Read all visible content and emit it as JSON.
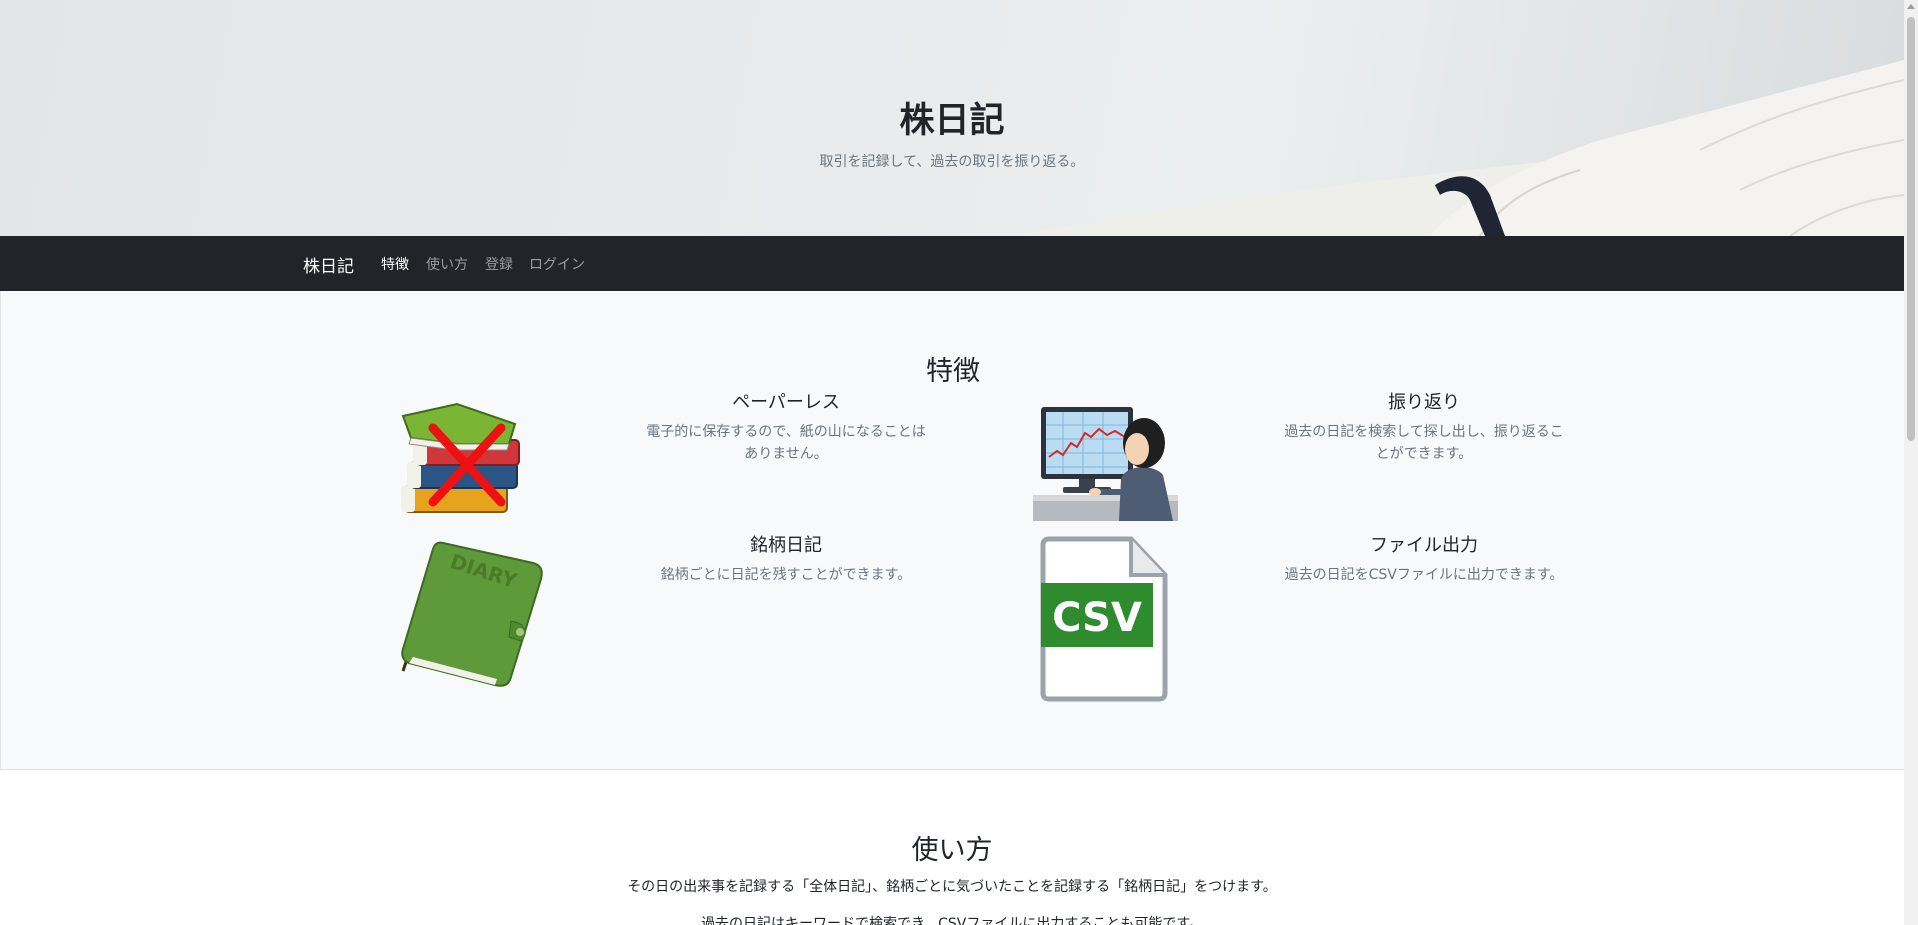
{
  "hero": {
    "title": "株日記",
    "subtitle": "取引を記録して、過去の取引を振り返る。"
  },
  "navbar": {
    "brand": "株日記",
    "items": [
      "特徴",
      "使い方",
      "登録",
      "ログイン"
    ],
    "active": "特徴"
  },
  "features": {
    "title": "特徴",
    "items": [
      {
        "heading": "ペーパーレス",
        "text_line1": "電子的に保存するので、紙の山になることは",
        "text_line2": "ありません。",
        "icon": "crossed-books-icon"
      },
      {
        "heading": "振り返り",
        "text_line1": "過去の日記を検索して探し出し、振り返るこ",
        "text_line2": "とができます。",
        "icon": "person-at-computer-icon"
      },
      {
        "heading": "銘柄日記",
        "text_line1": "銘柄ごとに日記を残すことができます。",
        "text_line2": "",
        "icon": "diary-book-icon"
      },
      {
        "heading": "ファイル出力",
        "text_line1": "過去の日記をCSVファイルに出力できます。",
        "text_line2": "",
        "icon": "csv-file-icon"
      }
    ],
    "csv_label": "CSV",
    "diary_label": "DIARY"
  },
  "usage": {
    "title": "使い方",
    "text1": "その日の出来事を記録する「全体日記」、銘柄ごとに気づいたことを記録する「銘柄日記」をつけます。",
    "text2": "過去の日記はキーワードで検索でき、CSVファイルに出力することも可能です。"
  },
  "colors": {
    "navbar_bg": "#212529",
    "section_bg": "#f8f9fa",
    "muted_text": "#6c757d",
    "csv_green": "#2e8b2e"
  }
}
